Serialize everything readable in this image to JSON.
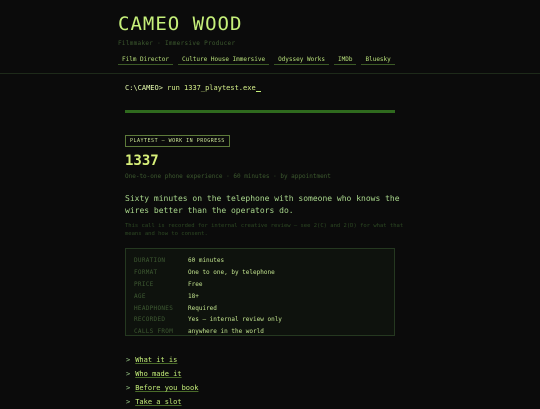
{
  "header": {
    "site_title": "CAMEO WOOD",
    "subtitle": "Filmmaker · Immersive Producer"
  },
  "nav": {
    "items": [
      {
        "label": "Film Director"
      },
      {
        "label": "Culture House Immersive"
      },
      {
        "label": "Odyssey Works"
      },
      {
        "label": "IMDb"
      },
      {
        "label": "Bluesky"
      }
    ]
  },
  "terminal": {
    "prompt": "C:\\CAMEO>",
    "command": "run 1337_playtest.exe"
  },
  "progress": {
    "fraction": 1.0
  },
  "play": {
    "badge": "PLAYTEST — WORK IN PROGRESS",
    "title": "1337",
    "tagline": "One-to-one phone experience · 60 minutes · by appointment",
    "lede": "Sixty minutes on the telephone with someone who knows the wires better than the operators do.",
    "note": "This call is recorded for internal creative review — see 2(C) and 2(D) for what that means and how to consent."
  },
  "details": {
    "rows": [
      {
        "key": "DURATION",
        "value": "60 minutes"
      },
      {
        "key": "FORMAT",
        "value": "One to one, by telephone"
      },
      {
        "key": "PRICE",
        "value": "Free"
      },
      {
        "key": "AGE",
        "value": "18+"
      },
      {
        "key": "HEADPHONES",
        "value": "Required"
      },
      {
        "key": "RECORDED",
        "value": "Yes — internal review only"
      },
      {
        "key": "CALLS FROM",
        "value": "anywhere in the world"
      }
    ]
  },
  "links": {
    "items": [
      {
        "label": "What it is"
      },
      {
        "label": "Who made it"
      },
      {
        "label": "Before you book"
      },
      {
        "label": "Take a slot"
      }
    ]
  },
  "colors": {
    "background": "#0b0b0b",
    "accent": "#c6f07a",
    "dim": "#3d5a2f"
  }
}
